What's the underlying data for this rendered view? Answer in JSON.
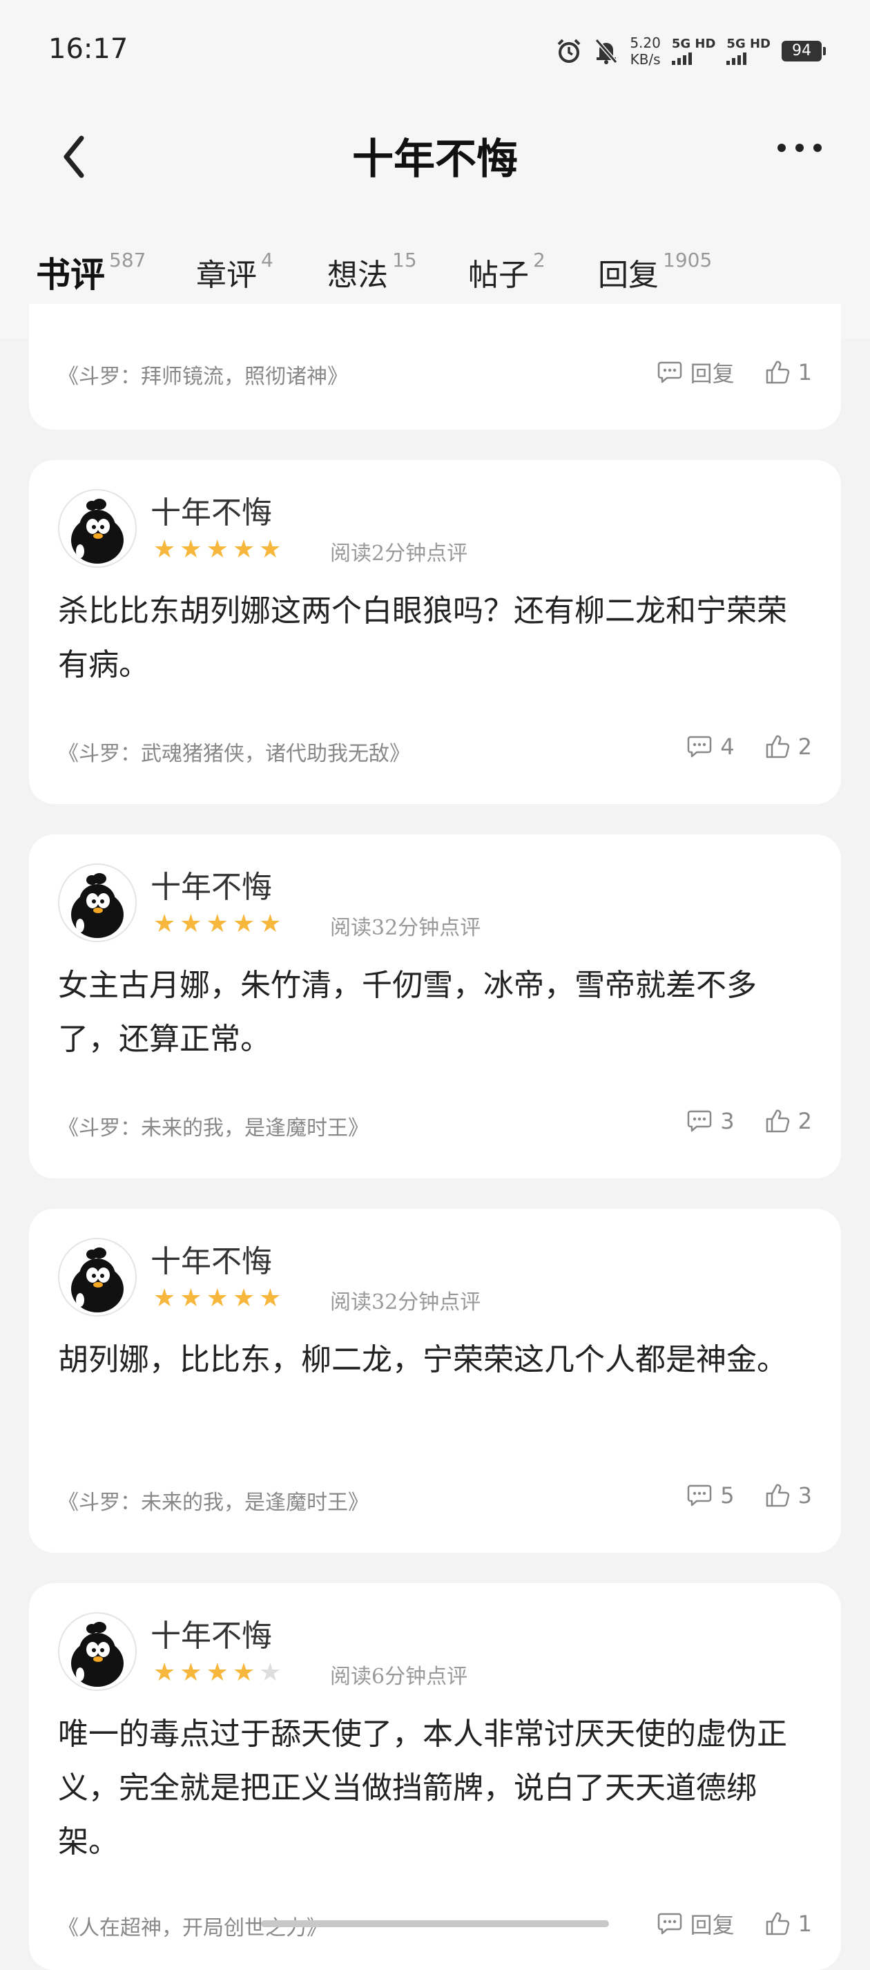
{
  "status_bar": {
    "time": "16:17",
    "speed_value": "5.20",
    "speed_unit": "KB/s",
    "net1": "5G HD",
    "net2": "5G HD",
    "battery": "94"
  },
  "nav": {
    "title": "十年不悔"
  },
  "tabs": [
    {
      "label": "书评",
      "count": "587"
    },
    {
      "label": "章评",
      "count": "4"
    },
    {
      "label": "想法",
      "count": "15"
    },
    {
      "label": "帖子",
      "count": "2"
    },
    {
      "label": "回复",
      "count": "1905"
    }
  ],
  "reviews": [
    {
      "book": "《斗罗：拜师镜流，照彻诸神》",
      "comments": "回复",
      "likes": "1"
    },
    {
      "user": "十年不悔",
      "stars": 5,
      "read_time": "阅读2分钟点评",
      "text": "杀比比东胡列娜这两个白眼狼吗？还有柳二龙和宁荣荣有病。",
      "book": "《斗罗：武魂猪猪侠，诸代助我无敌》",
      "comments": "4",
      "likes": "2"
    },
    {
      "user": "十年不悔",
      "stars": 5,
      "read_time": "阅读32分钟点评",
      "text": "女主古月娜，朱竹清，千仞雪，冰帝，雪帝就差不多了，还算正常。",
      "book": "《斗罗：未来的我，是逢魔时王》",
      "comments": "3",
      "likes": "2"
    },
    {
      "user": "十年不悔",
      "stars": 5,
      "read_time": "阅读32分钟点评",
      "text": "胡列娜，比比东，柳二龙，宁荣荣这几个人都是神金。",
      "book": "《斗罗：未来的我，是逢魔时王》",
      "comments": "5",
      "likes": "3"
    },
    {
      "user": "十年不悔",
      "stars": 4,
      "read_time": "阅读6分钟点评",
      "text": "唯一的毒点过于舔天使了，本人非常讨厌天使的虚伪正义，完全就是把正义当做挡箭牌，说白了天天道德绑架。",
      "book": "《人在超神，开局创世之力》",
      "comments": "回复",
      "likes": "1"
    }
  ]
}
